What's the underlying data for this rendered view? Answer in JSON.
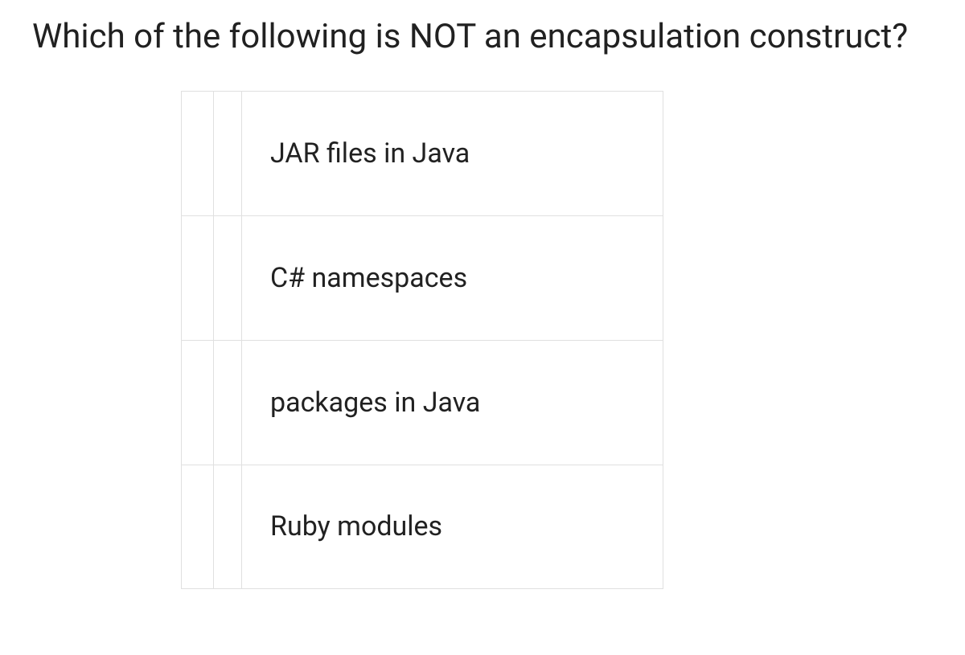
{
  "question": "Which of the following is NOT an encapsulation construct?",
  "options": [
    {
      "label": "JAR files in Java"
    },
    {
      "label": "C# namespaces"
    },
    {
      "label": "packages in Java"
    },
    {
      "label": "Ruby modules"
    }
  ]
}
